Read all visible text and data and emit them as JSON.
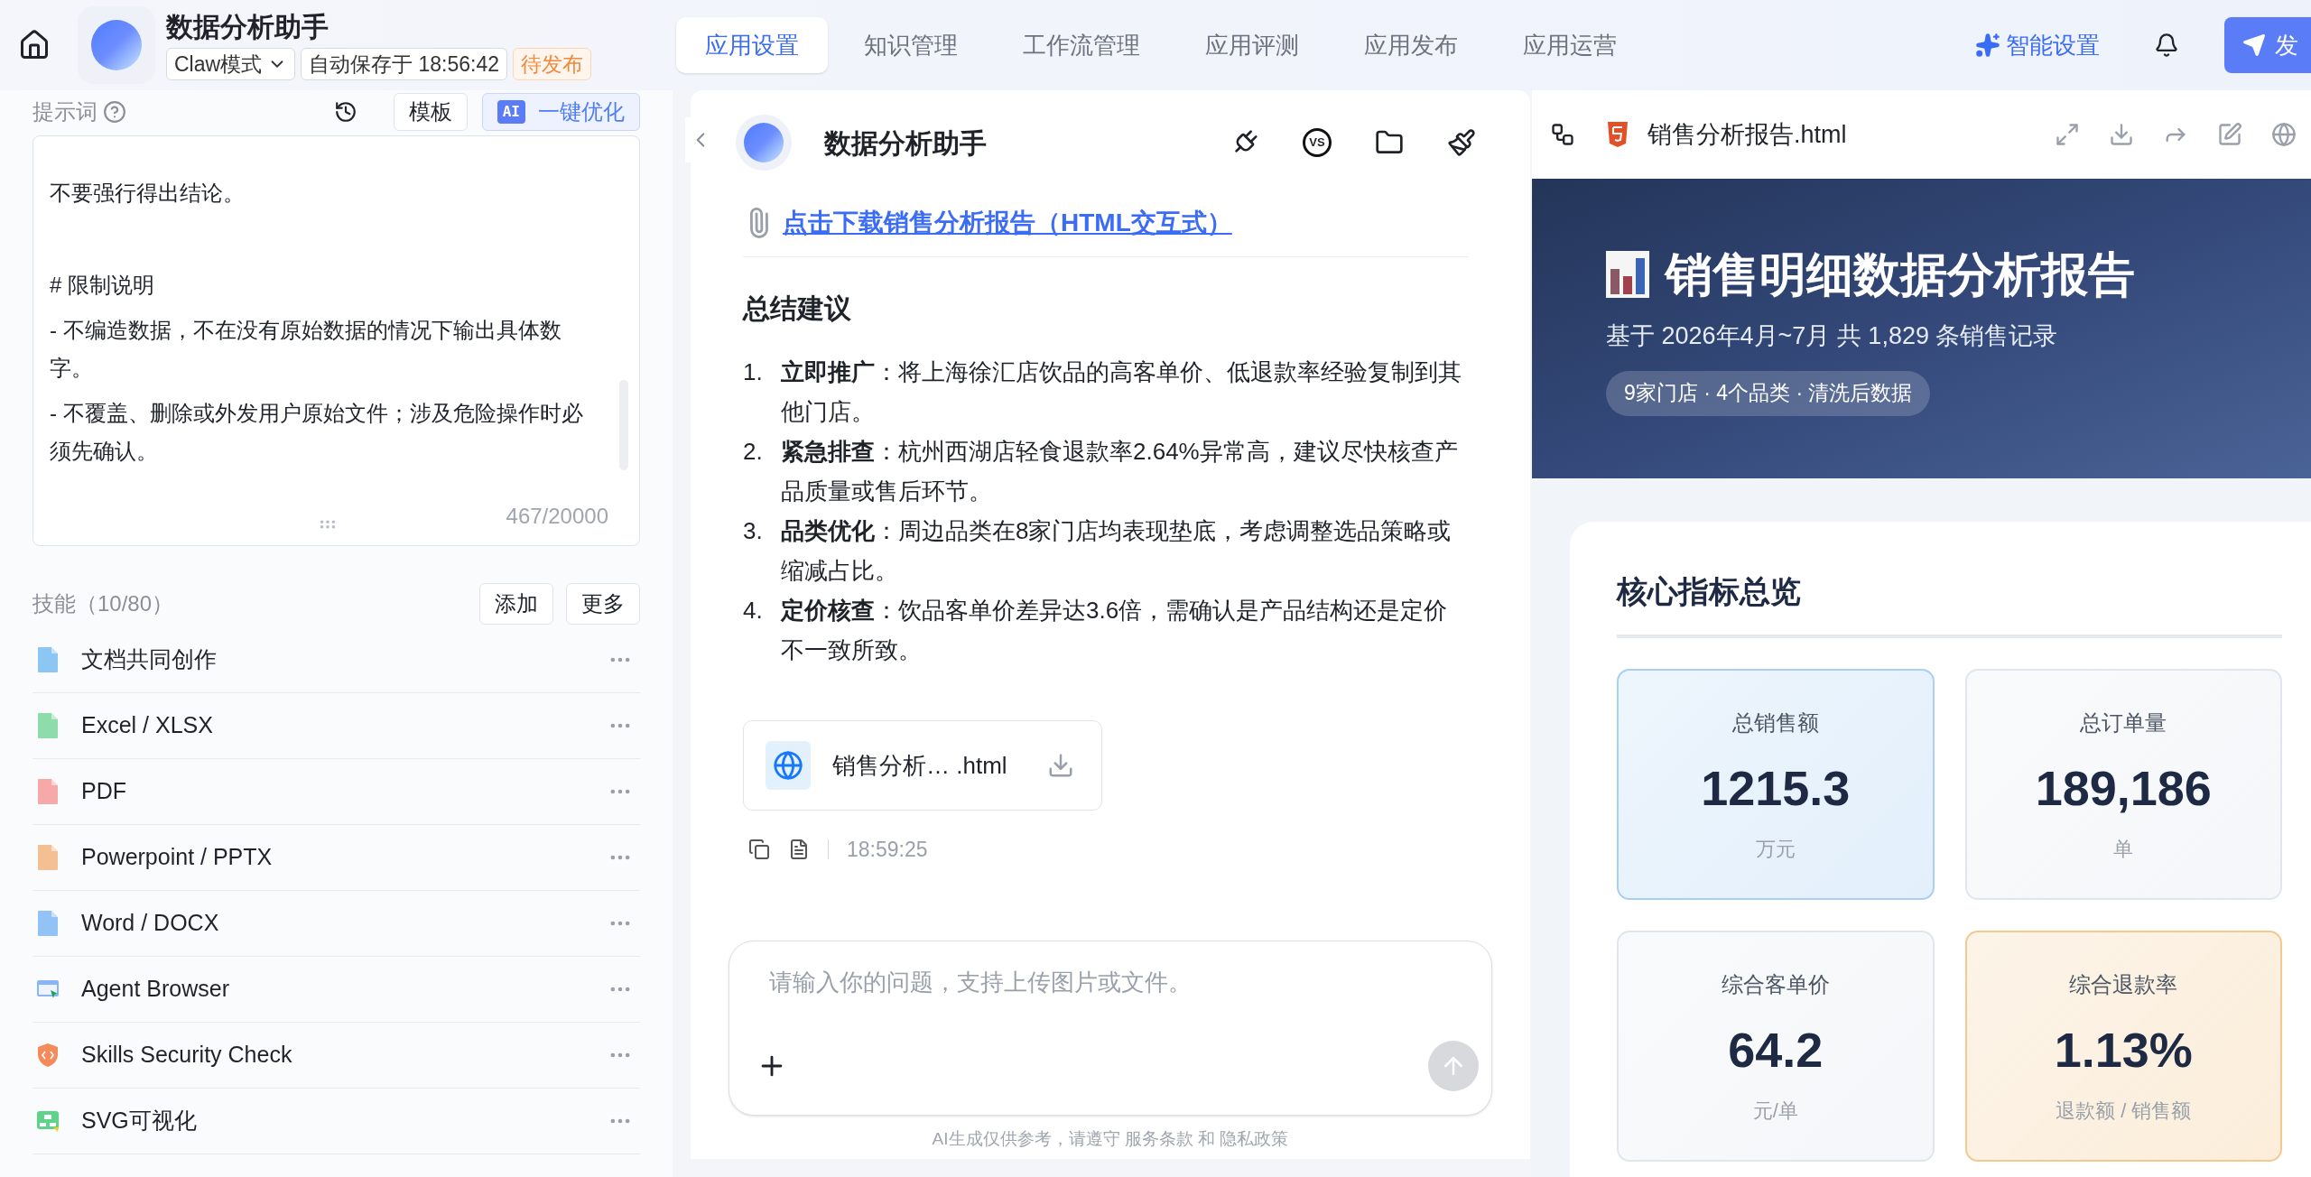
{
  "top_bar": {
    "app_title": "数据分析助手",
    "mode": "Claw模式",
    "autosave": "自动保存于 18:56:42",
    "status": "待发布",
    "tabs": [
      {
        "label": "应用设置",
        "selected": true
      },
      {
        "label": "知识管理",
        "selected": false
      },
      {
        "label": "工作流管理",
        "selected": false
      },
      {
        "label": "应用评测",
        "selected": false
      },
      {
        "label": "应用发布",
        "selected": false
      },
      {
        "label": "应用运营",
        "selected": false
      }
    ],
    "smart_settings": "智能设置",
    "publish": "发"
  },
  "prompt": {
    "label": "提示词",
    "template": "模板",
    "ai_badge": "AI",
    "optimize": "一键优化",
    "paragraphs": [
      {
        "kind": "text",
        "text": "不要强行得出结论。"
      },
      {
        "kind": "heading",
        "text": "# 限制说明"
      },
      {
        "kind": "text",
        "text": "- 不编造数据，不在没有原始数据的情况下输出具体数字。"
      },
      {
        "kind": "text",
        "text": "- 不覆盖、删除或外发用户原始文件；涉及危险操作时必须先确认。"
      }
    ],
    "count": "467/20000"
  },
  "skills": {
    "label": "技能（10/80）",
    "add": "添加",
    "more": "更多",
    "items": [
      {
        "name": "文档共同创作",
        "kind": "doc",
        "color": "#8cc6f3"
      },
      {
        "name": "Excel / XLSX",
        "kind": "doc",
        "color": "#8fdcab"
      },
      {
        "name": "PDF",
        "kind": "doc",
        "color": "#f7a9a9"
      },
      {
        "name": "Powerpoint / PPTX",
        "kind": "doc",
        "color": "#f5bf94"
      },
      {
        "name": "Word / DOCX",
        "kind": "doc",
        "color": "#93c2f6"
      },
      {
        "name": "Agent Browser",
        "kind": "browser",
        "color": "#8ab4f8"
      },
      {
        "name": "Skills Security Check",
        "kind": "shield",
        "color": "#f58a5c"
      },
      {
        "name": "SVG可视化",
        "kind": "diagram",
        "color": "#5fd38a"
      }
    ]
  },
  "chat": {
    "title": "数据分析助手",
    "tool_badge": "VS",
    "link": "点击下载销售分析报告（HTML交互式）",
    "heading": "总结建议",
    "items": [
      {
        "number": "1.",
        "text": "**立即推广**：将上海徐汇店饮品的高客单价、低退款率经验复制到其他门店。"
      },
      {
        "number": "2.",
        "text": "**紧急排查**：杭州西湖店轻食退款率2.64%异常高，建议尽快核查产品质量或售后环节。"
      },
      {
        "number": "3.",
        "text": "**品类优化**：周边品类在8家门店均表现垫底，考虑调整选品策略或缩减占比。"
      },
      {
        "number": "4.",
        "text": "**定价核查**：饮品客单价差异达3.6倍，需确认是产品结构还是定价不一致所致。"
      }
    ],
    "file_name": "销售分析… .html",
    "time": "18:59:25",
    "input": {
      "placeholder": "请输入你的问题，支持上传图片或文件。"
    },
    "footer": "AI生成仅供参考，请遵守 服务条款 和 隐私政策"
  },
  "preview": {
    "file_name": "销售分析报告.html",
    "title": "销售明细数据分析报告",
    "subtitle": "基于 2026年4月~7月 共 1,829 条销售记录",
    "pill": "9家门店 · 4个品类 · 清洗后数据",
    "section": "核心指标总览",
    "metrics": [
      {
        "label": "总销售额",
        "value": "1215.3",
        "unit": "万元",
        "color": "#a9cff3"
      },
      {
        "label": "总订单量",
        "value": "189,186",
        "unit": "单",
        "color": "#e1e6ee"
      },
      {
        "label": "综合客单价",
        "value": "64.2",
        "unit": "元/单",
        "color": "#e1e6ee"
      },
      {
        "label": "综合退款率",
        "value": "1.13%",
        "unit": "退款额 / 销售额",
        "color": "#f3c98f"
      }
    ]
  }
}
